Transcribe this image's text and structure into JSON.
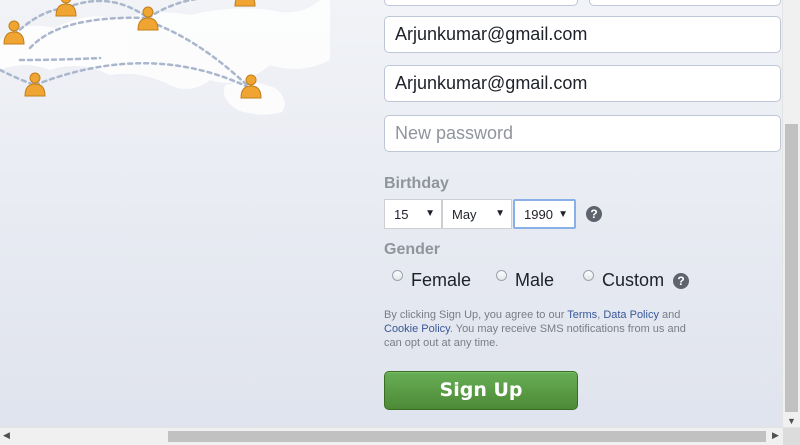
{
  "form": {
    "email_value": "Arjunkumar@gmail.com",
    "email_confirm_value": "Arjunkumar@gmail.com",
    "password_placeholder": "New password"
  },
  "birthday": {
    "label": "Birthday",
    "day": "15",
    "month": "May",
    "year": "1990",
    "help": "?"
  },
  "gender": {
    "label": "Gender",
    "options": [
      "Female",
      "Male",
      "Custom"
    ],
    "help": "?"
  },
  "terms": {
    "prefix": "By clicking Sign Up, you agree to our ",
    "terms_link": "Terms",
    "sep": ", ",
    "data_policy_link": "Data Policy",
    "and": " and ",
    "cookie_policy_link": "Cookie Policy",
    "suffix": ". You may receive SMS notifications from us and can opt out at any time."
  },
  "signup_label": "Sign Up",
  "colors": {
    "signup_green": "#5ba042",
    "link_blue": "#385898",
    "person_icon": "#f0a532"
  }
}
